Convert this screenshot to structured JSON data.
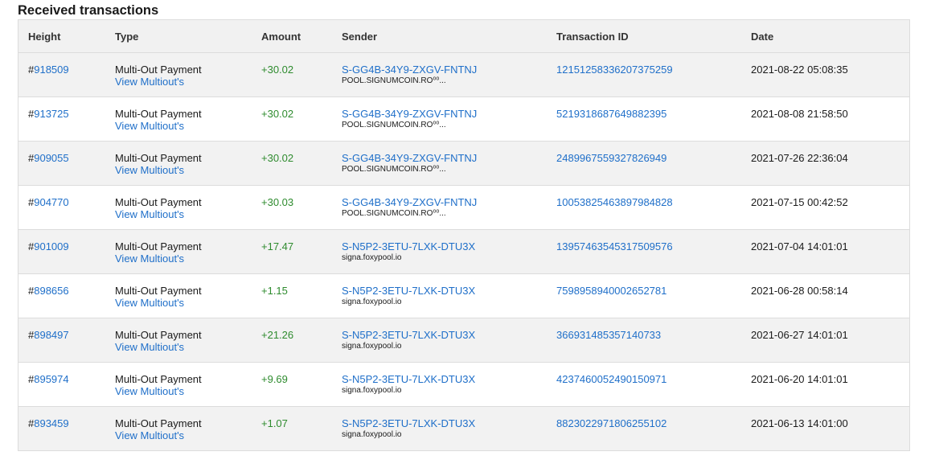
{
  "section": {
    "title": "Received transactions"
  },
  "table": {
    "columns": {
      "height": "Height",
      "type": "Type",
      "amount": "Amount",
      "sender": "Sender",
      "txid": "Transaction ID",
      "date": "Date"
    },
    "hash_prefix": "#",
    "rows": [
      {
        "height": "918509",
        "type": "Multi-Out Payment",
        "link": "View Multiout's",
        "amount": "+30.02",
        "sender": "S-GG4B-34Y9-ZXGV-FNTNJ",
        "sender_name": "POOL.SIGNUMCOIN.RO⁰⁰...",
        "txid": "12151258336207375259",
        "date": "2021-08-22 05:08:35"
      },
      {
        "height": "913725",
        "type": "Multi-Out Payment",
        "link": "View Multiout's",
        "amount": "+30.02",
        "sender": "S-GG4B-34Y9-ZXGV-FNTNJ",
        "sender_name": "POOL.SIGNUMCOIN.RO⁰⁰...",
        "txid": "5219318687649882395",
        "date": "2021-08-08 21:58:50"
      },
      {
        "height": "909055",
        "type": "Multi-Out Payment",
        "link": "View Multiout's",
        "amount": "+30.02",
        "sender": "S-GG4B-34Y9-ZXGV-FNTNJ",
        "sender_name": "POOL.SIGNUMCOIN.RO⁰⁰...",
        "txid": "2489967559327826949",
        "date": "2021-07-26 22:36:04"
      },
      {
        "height": "904770",
        "type": "Multi-Out Payment",
        "link": "View Multiout's",
        "amount": "+30.03",
        "sender": "S-GG4B-34Y9-ZXGV-FNTNJ",
        "sender_name": "POOL.SIGNUMCOIN.RO⁰⁰...",
        "txid": "10053825463897984828",
        "date": "2021-07-15 00:42:52"
      },
      {
        "height": "901009",
        "type": "Multi-Out Payment",
        "link": "View Multiout's",
        "amount": "+17.47",
        "sender": "S-N5P2-3ETU-7LXK-DTU3X",
        "sender_name": "signa.foxypool.io",
        "txid": "13957463545317509576",
        "date": "2021-07-04 14:01:01"
      },
      {
        "height": "898656",
        "type": "Multi-Out Payment",
        "link": "View Multiout's",
        "amount": "+1.15",
        "sender": "S-N5P2-3ETU-7LXK-DTU3X",
        "sender_name": "signa.foxypool.io",
        "txid": "7598958940002652781",
        "date": "2021-06-28 00:58:14"
      },
      {
        "height": "898497",
        "type": "Multi-Out Payment",
        "link": "View Multiout's",
        "amount": "+21.26",
        "sender": "S-N5P2-3ETU-7LXK-DTU3X",
        "sender_name": "signa.foxypool.io",
        "txid": "366931485357140733",
        "date": "2021-06-27 14:01:01"
      },
      {
        "height": "895974",
        "type": "Multi-Out Payment",
        "link": "View Multiout's",
        "amount": "+9.69",
        "sender": "S-N5P2-3ETU-7LXK-DTU3X",
        "sender_name": "signa.foxypool.io",
        "txid": "4237460052490150971",
        "date": "2021-06-20 14:01:01"
      },
      {
        "height": "893459",
        "type": "Multi-Out Payment",
        "link": "View Multiout's",
        "amount": "+1.07",
        "sender": "S-N5P2-3ETU-7LXK-DTU3X",
        "sender_name": "signa.foxypool.io",
        "txid": "8823022971806255102",
        "date": "2021-06-13 14:01:00"
      }
    ]
  },
  "colors": {
    "link": "#1f6fc9",
    "amount_positive": "#2e8b2e",
    "row_alt": "#f2f2f2",
    "header_bg": "#f1f1f1"
  }
}
